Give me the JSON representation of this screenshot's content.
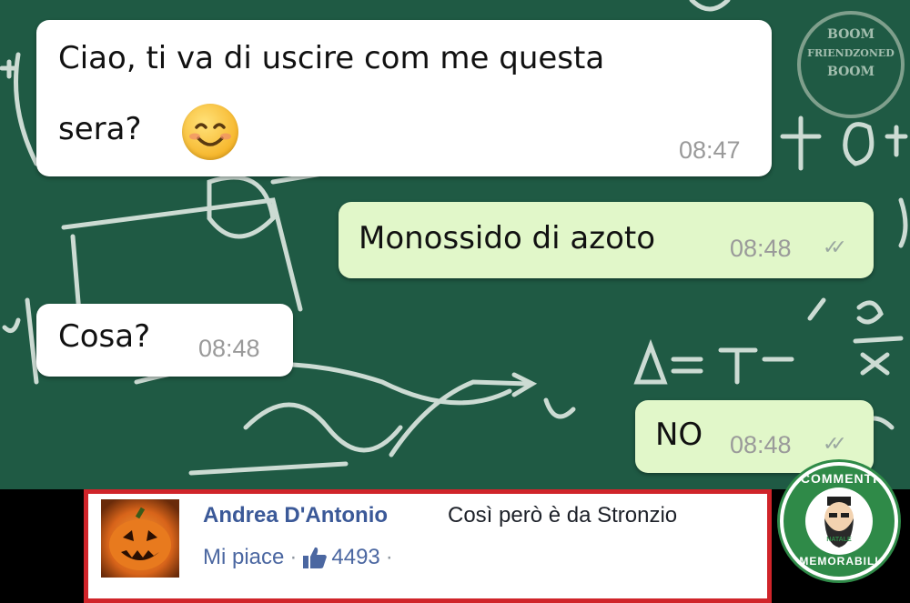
{
  "chat": {
    "messages": [
      {
        "direction": "incoming",
        "line1": "Ciao, ti va di uscire com me questa",
        "line2": "sera?",
        "has_emoji": true,
        "emoji": "smiling-face",
        "time": "08:47"
      },
      {
        "direction": "outgoing",
        "text": "Monossido di azoto",
        "time": "08:48",
        "status": "double-check"
      },
      {
        "direction": "incoming",
        "text": "Cosa?",
        "time": "08:48"
      },
      {
        "direction": "outgoing",
        "text": "NO",
        "time": "08:48",
        "status": "double-check"
      }
    ],
    "background_color": "#1f5a44",
    "chalk_formula": "ΔT = T − 3o/x"
  },
  "watermark": {
    "line1": "BOOM",
    "line2": "FRIENDZONED",
    "line3": "BOOM"
  },
  "comment": {
    "author": "Andrea D'Antonio",
    "text": "Così però è da Stronzio",
    "like_label": "Mi piace",
    "separator": "·",
    "like_count": "4493",
    "avatar": "pumpkin-avatar",
    "highlight_color": "#d0242a",
    "author_color": "#3b5998"
  },
  "badge": {
    "top": "COMMENTI",
    "bottom": "MEMORABILI",
    "center": "NATALE",
    "icon": "bearded-face-icon",
    "color": "#2f8a48"
  },
  "ticks_glyph": "✓✓"
}
